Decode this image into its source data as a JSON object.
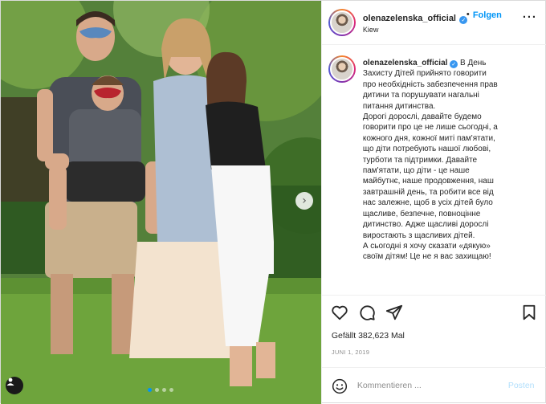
{
  "post": {
    "username": "olenazelenska_official",
    "verified": true,
    "separator": "•",
    "follow_label": "Folgen",
    "location": "Kiew",
    "more_label": "···",
    "caption_lines": [
      "В День",
      "Захисту Дітей прийнято говорити",
      "про необхідність забезпечення прав",
      "дитини та порушувати нагальні",
      "питання дитинства.",
      "Дорогі дорослі, давайте будемо",
      "говорити про це не лише сьогодні, а",
      "кожного дня, кожної миті пам'ятати,",
      "що діти потребують нашої любові,",
      "турботи та підтримки. Давайте",
      "пам'ятати, що діти - це наше",
      "майбутнє, наше продовження, наш",
      "завтрашній день, та робити все від",
      "нас залежне, щоб в усіх дітей було",
      "щасливе, безпечне, повноцінне",
      "дитинство. Адже щасливі дорослі",
      "виростають з щасливих дітей.",
      "А сьогодні я хочу сказати «дякую»",
      "своїм дітям! Це не я вас захищаю!"
    ],
    "likes_text": "Gefällt 382,623 Mal",
    "date_text": "JUNI 1, 2019",
    "comment_placeholder": "Kommentieren ...",
    "post_button": "Posten",
    "carousel": {
      "count": 4,
      "active_index": 0
    }
  },
  "icons": {
    "like": "heart-icon",
    "comment": "comment-icon",
    "share": "paper-plane-icon",
    "save": "bookmark-icon",
    "emoji": "smiley-icon",
    "next": "chevron-right-icon",
    "tags": "user-tag-icon"
  },
  "colors": {
    "accent": "#0095f6",
    "verified": "#3897f0",
    "muted": "#8e8e8e",
    "border": "#efefef"
  }
}
